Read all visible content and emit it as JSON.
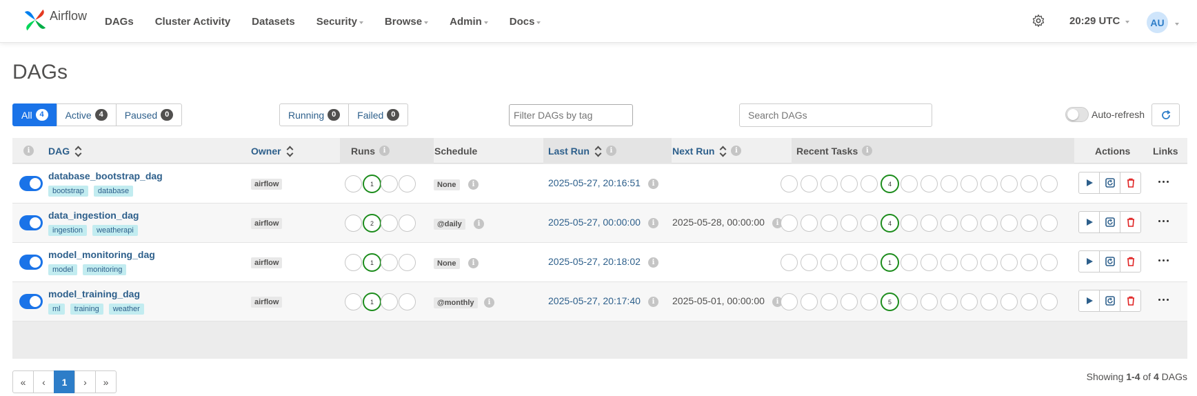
{
  "brand": {
    "name": "Airflow"
  },
  "nav": {
    "items": [
      {
        "label": "DAGs",
        "dropdown": false
      },
      {
        "label": "Cluster Activity",
        "dropdown": false
      },
      {
        "label": "Datasets",
        "dropdown": false
      },
      {
        "label": "Security",
        "dropdown": true
      },
      {
        "label": "Browse",
        "dropdown": true
      },
      {
        "label": "Admin",
        "dropdown": true
      },
      {
        "label": "Docs",
        "dropdown": true
      }
    ],
    "time": "20:29 UTC",
    "user_initials": "AU"
  },
  "page": {
    "title": "DAGs"
  },
  "filters": {
    "status": [
      {
        "label": "All",
        "count": "4",
        "active": true
      },
      {
        "label": "Active",
        "count": "4",
        "active": false
      },
      {
        "label": "Paused",
        "count": "0",
        "active": false
      }
    ],
    "runs": [
      {
        "label": "Running",
        "count": "0"
      },
      {
        "label": "Failed",
        "count": "0"
      }
    ],
    "tag_placeholder": "Filter DAGs by tag",
    "search_placeholder": "Search DAGs",
    "auto_refresh_label": "Auto-refresh"
  },
  "table": {
    "headers": {
      "dag": "DAG",
      "owner": "Owner",
      "runs": "Runs",
      "schedule": "Schedule",
      "last_run": "Last Run",
      "next_run": "Next Run",
      "recent_tasks": "Recent Tasks",
      "actions": "Actions",
      "links": "Links"
    },
    "rows": [
      {
        "name": "database_bootstrap_dag",
        "tags": [
          "bootstrap",
          "database"
        ],
        "owner": "airflow",
        "runs_success": "1",
        "schedule": "None",
        "last_run": "2025-05-27, 20:16:51",
        "next_run": "",
        "recent_success": "4"
      },
      {
        "name": "data_ingestion_dag",
        "tags": [
          "ingestion",
          "weatherapi"
        ],
        "owner": "airflow",
        "runs_success": "2",
        "schedule": "@daily",
        "last_run": "2025-05-27, 00:00:00",
        "next_run": "2025-05-28, 00:00:00",
        "recent_success": "4"
      },
      {
        "name": "model_monitoring_dag",
        "tags": [
          "model",
          "monitoring"
        ],
        "owner": "airflow",
        "runs_success": "1",
        "schedule": "None",
        "last_run": "2025-05-27, 20:18:02",
        "next_run": "",
        "recent_success": "1"
      },
      {
        "name": "model_training_dag",
        "tags": [
          "ml",
          "training",
          "weather"
        ],
        "owner": "airflow",
        "runs_success": "1",
        "schedule": "@monthly",
        "last_run": "2025-05-27, 20:17:40",
        "next_run": "2025-05-01, 00:00:00",
        "recent_success": "5"
      }
    ]
  },
  "pagination": {
    "first": "«",
    "prev": "‹",
    "current": "1",
    "next": "›",
    "last": "»"
  },
  "footer": {
    "showing_prefix": "Showing",
    "range": "1-4",
    "of": "of",
    "total": "4",
    "suffix": "DAGs"
  },
  "colors": {
    "primary": "#1a73e8",
    "link": "#2d5f8b",
    "success": "#1c8c1c",
    "danger": "#e02424",
    "tag_bg": "#c2ecf0"
  }
}
